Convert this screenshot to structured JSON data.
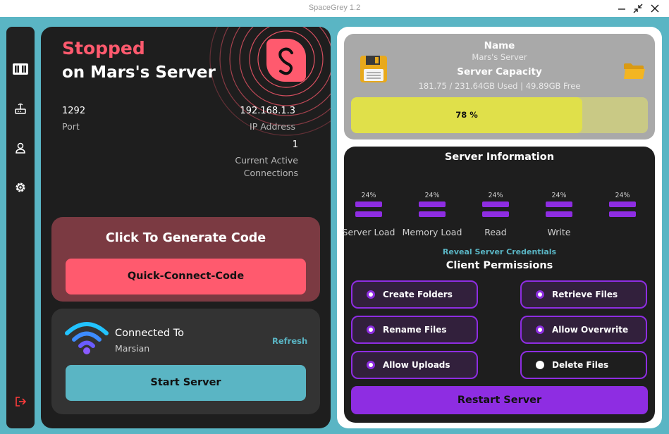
{
  "window": {
    "title": "SpaceGrey 1.2",
    "controls": [
      "minimize-icon",
      "restore-icon",
      "close-icon"
    ]
  },
  "sidebar": {
    "items": [
      {
        "icon": "dashboard-icon",
        "active": true
      },
      {
        "icon": "router-icon"
      },
      {
        "icon": "user-icon"
      },
      {
        "icon": "gear-icon"
      }
    ],
    "logout_icon": "logout-icon"
  },
  "status": {
    "state": "Stopped",
    "server_line": "on Mars's Server",
    "port_value": "1292",
    "port_label": "Port",
    "ip_value": "192.168.1.3",
    "ip_label": "IP Address",
    "connections_value": "1",
    "connections_label_1": "Current Active",
    "connections_label_2": "Connections"
  },
  "generate": {
    "title": "Click To Generate Code",
    "button": "Quick-Connect-Code"
  },
  "connection": {
    "title": "Connected To",
    "network": "Marsian",
    "refresh": "Refresh",
    "start_button": "Start Server"
  },
  "storage": {
    "name_label": "Name",
    "server_name": "Mars's Server",
    "capacity_label": "Server Capacity",
    "usage_text": "181.75 / 231.64GB Used | 49.89GB Free",
    "percent_text": "78 %",
    "percent": 78
  },
  "server_info": {
    "title": "Server Information",
    "metrics": [
      {
        "label": "Server Load",
        "value": "24%"
      },
      {
        "label": "Memory Load",
        "value": "24%"
      },
      {
        "label": "Read",
        "value": "24%"
      },
      {
        "label": "Write",
        "value": "24%"
      },
      {
        "label": "",
        "value": "24%"
      }
    ],
    "reveal": "Reveal Server Credentials",
    "permissions_title": "Client Permissions",
    "permissions": [
      {
        "label": "Create Folders",
        "enabled": true
      },
      {
        "label": "Retrieve Files",
        "enabled": true
      },
      {
        "label": "Rename Files",
        "enabled": true
      },
      {
        "label": "Allow Overwrite",
        "enabled": true
      },
      {
        "label": "Allow Uploads",
        "enabled": true
      },
      {
        "label": "Delete Files",
        "enabled": false
      }
    ],
    "restart_button": "Restart Server"
  },
  "colors": {
    "accent_teal": "#5ab5c4",
    "accent_red": "#ff5a6e",
    "accent_purple": "#8e2de2",
    "panel_dark": "#1e1e1e",
    "capacity_bar": "#e0e04a"
  }
}
